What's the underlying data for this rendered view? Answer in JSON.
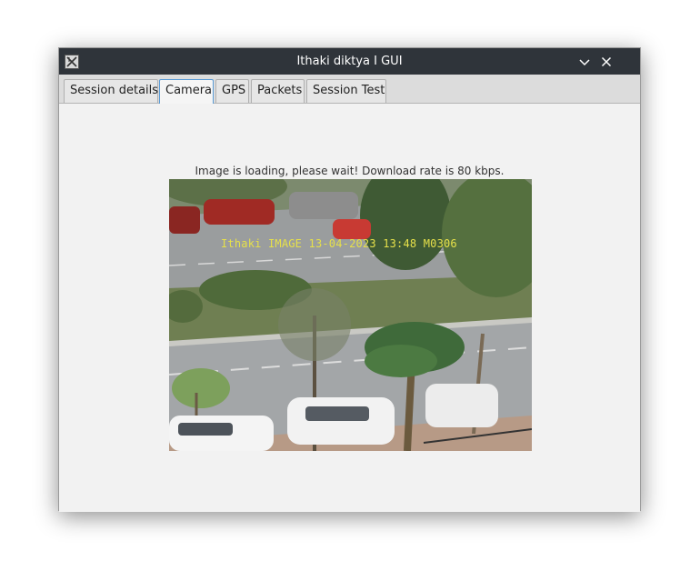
{
  "window": {
    "title": "Ithaki diktya I GUI"
  },
  "tabs": [
    {
      "label": "Session details",
      "active": false
    },
    {
      "label": "Camera",
      "active": true
    },
    {
      "label": "GPS",
      "active": false
    },
    {
      "label": "Packets",
      "active": false
    },
    {
      "label": "Session Test",
      "active": false
    }
  ],
  "camera": {
    "status_text": "Image is loading, please wait! Download rate is 80 kbps.",
    "overlay_text": "Ithaki IMAGE 13-04-2023 13:48 M0306"
  },
  "colors": {
    "titlebar": "#2f343a",
    "active_tab_border": "#5a9bd6",
    "overlay_text": "#e6e04a"
  }
}
